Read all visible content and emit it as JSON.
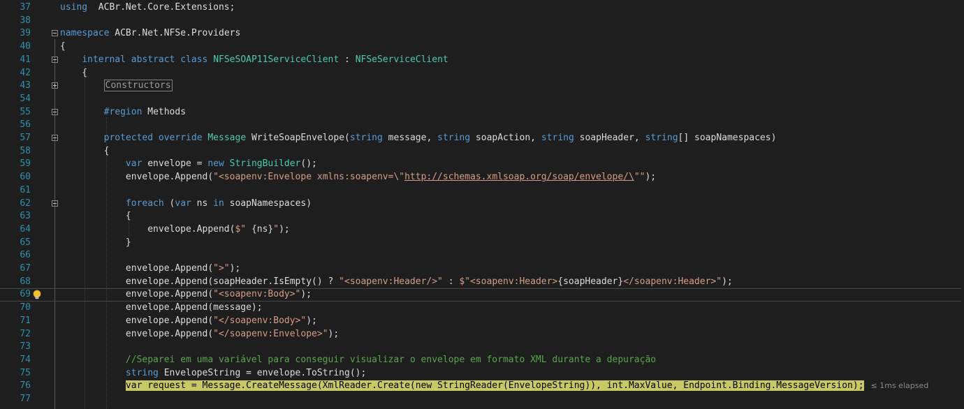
{
  "editor": {
    "lines": [
      {
        "num": "37",
        "fold": "",
        "segs": [
          [
            "kw",
            "using"
          ],
          [
            "",
            "  ACBr.Net.Core.Extensions;"
          ]
        ]
      },
      {
        "num": "38",
        "fold": "",
        "segs": []
      },
      {
        "num": "39",
        "fold": "minus",
        "segs": [
          [
            "kw",
            "namespace"
          ],
          [
            "",
            " ACBr.Net.NFSe.Providers"
          ]
        ]
      },
      {
        "num": "40",
        "fold": "",
        "segs": [
          [
            "",
            "{"
          ]
        ]
      },
      {
        "num": "41",
        "fold": "minus",
        "segs": [
          [
            "",
            "    "
          ],
          [
            "kw",
            "internal"
          ],
          [
            "",
            " "
          ],
          [
            "kw",
            "abstract"
          ],
          [
            "",
            " "
          ],
          [
            "kw",
            "class"
          ],
          [
            "",
            " "
          ],
          [
            "ty",
            "NFSeSOAP11ServiceClient"
          ],
          [
            "",
            " : "
          ],
          [
            "ty",
            "NFSeServiceClient"
          ]
        ]
      },
      {
        "num": "42",
        "fold": "",
        "segs": [
          [
            "",
            "    {"
          ]
        ]
      },
      {
        "num": "43",
        "fold": "plus",
        "segs": [
          [
            "",
            "        "
          ],
          [
            "box",
            "Constructors"
          ]
        ]
      },
      {
        "num": "54",
        "fold": "",
        "segs": []
      },
      {
        "num": "55",
        "fold": "minus",
        "segs": [
          [
            "",
            "        "
          ],
          [
            "kw",
            "#region"
          ],
          [
            "",
            " Methods"
          ]
        ]
      },
      {
        "num": "56",
        "fold": "",
        "segs": []
      },
      {
        "num": "57",
        "fold": "minus",
        "segs": [
          [
            "",
            "        "
          ],
          [
            "kw",
            "protected"
          ],
          [
            "",
            " "
          ],
          [
            "kw",
            "override"
          ],
          [
            "",
            " "
          ],
          [
            "ty",
            "Message"
          ],
          [
            "",
            " WriteSoapEnvelope("
          ],
          [
            "kw",
            "string"
          ],
          [
            "",
            " message, "
          ],
          [
            "kw",
            "string"
          ],
          [
            "",
            " soapAction, "
          ],
          [
            "kw",
            "string"
          ],
          [
            "",
            " soapHeader, "
          ],
          [
            "kw",
            "string"
          ],
          [
            "",
            "[] soapNamespaces)"
          ]
        ]
      },
      {
        "num": "58",
        "fold": "",
        "segs": [
          [
            "",
            "        {"
          ]
        ]
      },
      {
        "num": "59",
        "fold": "",
        "segs": [
          [
            "",
            "            "
          ],
          [
            "kw",
            "var"
          ],
          [
            "",
            " envelope = "
          ],
          [
            "kw",
            "new"
          ],
          [
            "",
            " "
          ],
          [
            "ty",
            "StringBuilder"
          ],
          [
            "",
            "();"
          ]
        ]
      },
      {
        "num": "60",
        "fold": "",
        "segs": [
          [
            "",
            "            envelope.Append("
          ],
          [
            "st",
            "\"<soapenv:Envelope xmlns:soapenv=\\\""
          ],
          [
            "url",
            "http://schemas.xmlsoap.org/soap/envelope/\\"
          ],
          [
            "st",
            "\"\""
          ],
          [
            "",
            ");"
          ]
        ]
      },
      {
        "num": "61",
        "fold": "",
        "segs": []
      },
      {
        "num": "62",
        "fold": "minus",
        "segs": [
          [
            "",
            "            "
          ],
          [
            "kw",
            "foreach"
          ],
          [
            "",
            " ("
          ],
          [
            "kw",
            "var"
          ],
          [
            "",
            " ns "
          ],
          [
            "kw",
            "in"
          ],
          [
            "",
            " soapNamespaces)"
          ]
        ]
      },
      {
        "num": "63",
        "fold": "",
        "segs": [
          [
            "",
            "            {"
          ]
        ]
      },
      {
        "num": "64",
        "fold": "",
        "segs": [
          [
            "",
            "                envelope.Append("
          ],
          [
            "st",
            "$\" "
          ],
          [
            "",
            "{ns}"
          ],
          [
            "st",
            "\""
          ],
          [
            "",
            ");"
          ]
        ]
      },
      {
        "num": "65",
        "fold": "",
        "segs": [
          [
            "",
            "            }"
          ]
        ]
      },
      {
        "num": "66",
        "fold": "",
        "segs": []
      },
      {
        "num": "67",
        "fold": "",
        "segs": [
          [
            "",
            "            envelope.Append("
          ],
          [
            "st",
            "\">\""
          ],
          [
            "",
            ");"
          ]
        ]
      },
      {
        "num": "68",
        "fold": "",
        "segs": [
          [
            "",
            "            envelope.Append(soapHeader.IsEmpty() ? "
          ],
          [
            "st",
            "\"<soapenv:Header/>\""
          ],
          [
            "",
            " : "
          ],
          [
            "st",
            "$\"<soapenv:Header>"
          ],
          [
            "",
            "{soapHeader}"
          ],
          [
            "st",
            "</soapenv:Header>\""
          ],
          [
            "",
            ");"
          ]
        ]
      },
      {
        "num": "69",
        "fold": "",
        "current": true,
        "bulb": true,
        "segs": [
          [
            "",
            "            envelope.Append("
          ],
          [
            "st",
            "\"<soapenv:Body>\""
          ],
          [
            "",
            ");"
          ]
        ]
      },
      {
        "num": "70",
        "fold": "",
        "segs": [
          [
            "",
            "            envelope.Append(message);"
          ]
        ]
      },
      {
        "num": "71",
        "fold": "",
        "segs": [
          [
            "",
            "            envelope.Append("
          ],
          [
            "st",
            "\"</soapenv:Body>\""
          ],
          [
            "",
            ");"
          ]
        ]
      },
      {
        "num": "72",
        "fold": "",
        "segs": [
          [
            "",
            "            envelope.Append("
          ],
          [
            "st",
            "\"</soapenv:Envelope>\""
          ],
          [
            "",
            ");"
          ]
        ]
      },
      {
        "num": "73",
        "fold": "",
        "segs": []
      },
      {
        "num": "74",
        "fold": "",
        "segs": [
          [
            "",
            "            "
          ],
          [
            "cm",
            "//Separei em uma variável para conseguir visualizar o envelope em formato XML durante a depuração"
          ]
        ]
      },
      {
        "num": "75",
        "fold": "",
        "segs": [
          [
            "",
            "            "
          ],
          [
            "kw",
            "string"
          ],
          [
            "",
            " EnvelopeString = envelope.ToString();"
          ]
        ]
      },
      {
        "num": "76",
        "fold": "",
        "segs": [
          [
            "",
            "            "
          ],
          [
            "hl",
            "var request = Message.CreateMessage(XmlReader.Create(new StringReader(EnvelopeString)), int.MaxValue, Endpoint.Binding.MessageVersion);"
          ],
          [
            "elapsed",
            "≤ 1ms elapsed"
          ]
        ]
      },
      {
        "num": "77",
        "fold": "",
        "segs": []
      }
    ]
  },
  "colors": {
    "background": "#1e1e1e",
    "line_number": "#2b91af",
    "keyword": "#569cd6",
    "type": "#4ec9b0",
    "string": "#d69d85",
    "comment": "#57a64a",
    "text": "#dcdcdc",
    "current_statement": "#c8c864"
  },
  "icons": {
    "lightbulb": "lightbulb-icon",
    "fold_expanded": "collapse-minus-icon",
    "fold_collapsed": "expand-plus-icon"
  }
}
